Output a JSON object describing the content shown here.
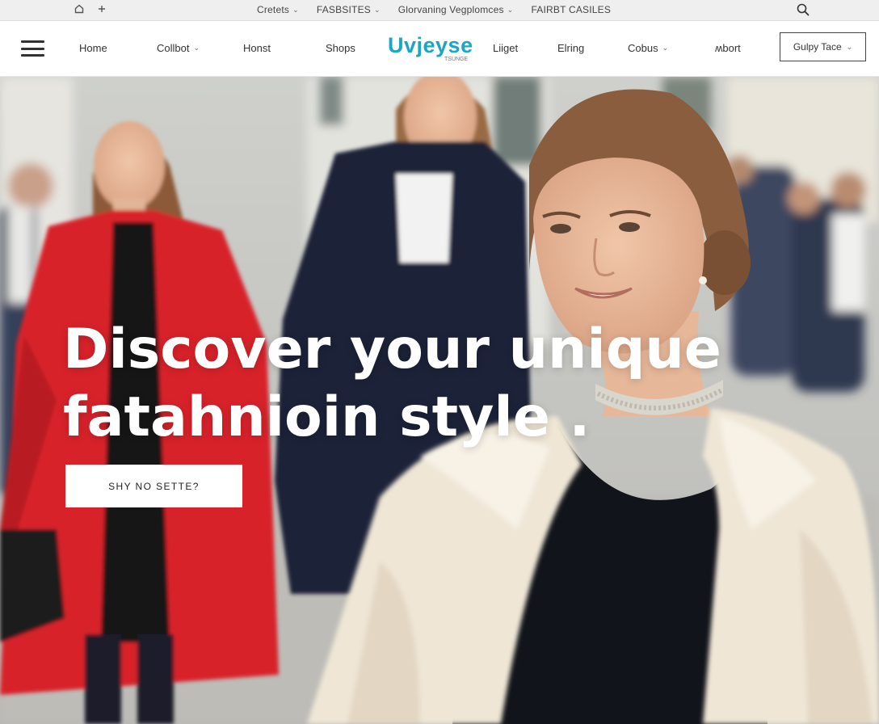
{
  "utility_bar": {
    "items": [
      {
        "label": "Cretets",
        "has_dropdown": true
      },
      {
        "label": "FASBSITES",
        "has_dropdown": true
      },
      {
        "label": "Glorvaning Vegplomces",
        "has_dropdown": true
      },
      {
        "label": "FAIRBT CASILES",
        "has_dropdown": false
      }
    ],
    "left_icons": [
      "home-icon",
      "plus-icon"
    ],
    "search_icon": "search-icon"
  },
  "nav": {
    "links": [
      {
        "label": "Home",
        "has_dropdown": false
      },
      {
        "label": "Collbot",
        "has_dropdown": true
      },
      {
        "label": "Honst",
        "has_dropdown": false
      },
      {
        "label": "Shops",
        "has_dropdown": false
      },
      {
        "label": "Liiget",
        "has_dropdown": false
      },
      {
        "label": "Elring",
        "has_dropdown": false
      },
      {
        "label": "Cobus",
        "has_dropdown": true
      },
      {
        "label": "ʍbort",
        "has_dropdown": false
      }
    ],
    "logo": {
      "text": "Uvjeyse",
      "subtext": "TSUNGE"
    },
    "select_label": "Gulpy Tace"
  },
  "hero": {
    "headline_line1": "Discover your unique",
    "headline_line2": "fatahnioin style .",
    "cta_label": "SHY NO SETTE?"
  },
  "colors": {
    "logo": "#1aa6c4",
    "hero_text": "#ffffff",
    "red_coat": "#d8222a",
    "cream_coat": "#efe6d6"
  }
}
